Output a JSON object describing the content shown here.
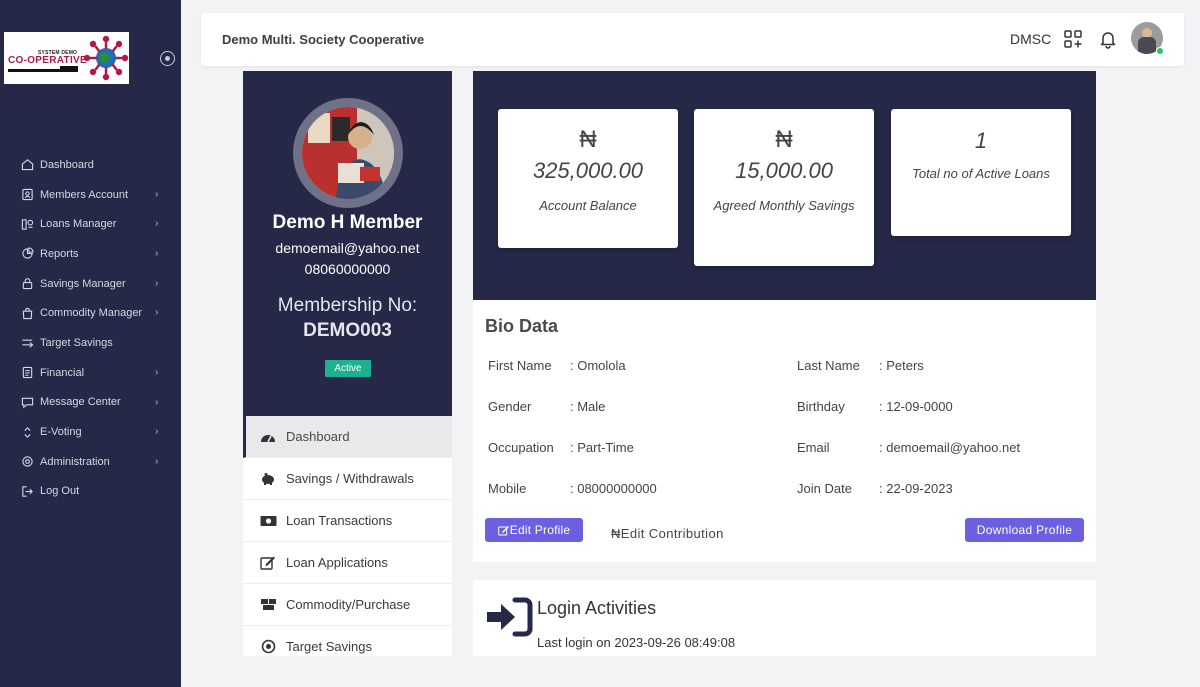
{
  "brand": {
    "logo_small_text": "SYSTEM DEMO",
    "logo_main_text": "CO-OPERATIVE"
  },
  "sidebar": {
    "items": [
      {
        "label": "Dashboard",
        "icon": "home-icon",
        "has_submenu": false
      },
      {
        "label": "Members Account",
        "icon": "user-book-icon",
        "has_submenu": true
      },
      {
        "label": "Loans Manager",
        "icon": "loans-icon",
        "has_submenu": true
      },
      {
        "label": "Reports",
        "icon": "pie-chart-icon",
        "has_submenu": true
      },
      {
        "label": "Savings Manager",
        "icon": "lock-icon",
        "has_submenu": true
      },
      {
        "label": "Commodity Manager",
        "icon": "shopping-bag-icon",
        "has_submenu": true
      },
      {
        "label": "Target Savings",
        "icon": "target-arrow-icon",
        "has_submenu": false
      },
      {
        "label": "Financial",
        "icon": "ledger-icon",
        "has_submenu": true
      },
      {
        "label": "Message Center",
        "icon": "message-icon",
        "has_submenu": true
      },
      {
        "label": "E-Voting",
        "icon": "vote-icon",
        "has_submenu": true
      },
      {
        "label": "Administration",
        "icon": "settings-icon",
        "has_submenu": true
      },
      {
        "label": "Log Out",
        "icon": "logout-icon",
        "has_submenu": false
      }
    ]
  },
  "header": {
    "org_title": "Demo Multi. Society Cooperative",
    "org_code": "DMSC"
  },
  "profile": {
    "name": "Demo H Member",
    "email": "demoemail@yahoo.net",
    "phone": "08060000000",
    "membership_label": "Membership No:",
    "membership_no": "DEMO003",
    "status": "Active"
  },
  "member_menu": {
    "items": [
      {
        "label": "Dashboard",
        "active": true
      },
      {
        "label": "Savings / Withdrawals",
        "active": false
      },
      {
        "label": "Loan Transactions",
        "active": false
      },
      {
        "label": "Loan Applications",
        "active": false
      },
      {
        "label": "Commodity/Purchase",
        "active": false
      },
      {
        "label": "Target Savings",
        "active": false
      }
    ]
  },
  "stats": {
    "account_balance": {
      "currency": "₦",
      "value": "325,000.00",
      "label": "Account Balance"
    },
    "monthly_savings": {
      "currency": "₦",
      "value": "15,000.00",
      "label": "Agreed Monthly Savings"
    },
    "active_loans": {
      "value": "1",
      "label": "Total no of Active Loans"
    }
  },
  "bio": {
    "title": "Bio Data",
    "fields": [
      {
        "label": "First Name",
        "value": ": Omolola"
      },
      {
        "label": "Last Name",
        "value": ": Peters"
      },
      {
        "label": "Gender",
        "value": ": Male"
      },
      {
        "label": "Birthday",
        "value": ": 12-09-0000"
      },
      {
        "label": "Occupation",
        "value": ": Part-Time"
      },
      {
        "label": "Email",
        "value": ": demoemail@yahoo.net"
      },
      {
        "label": "Mobile",
        "value": ": 08000000000"
      },
      {
        "label": "Join Date",
        "value": ": 22-09-2023"
      }
    ],
    "edit_profile_label": "Edit Profile",
    "edit_contribution_label": "₦Edit Contribution",
    "download_profile_label": "Download Profile"
  },
  "login_activities": {
    "title": "Login Activities",
    "last_login": "Last login on 2023-09-26 08:49:08"
  },
  "colors": {
    "sidebar_bg": "#252846",
    "accent_button": "#6c5fe0",
    "status_active": "#1fb18f",
    "online": "#27c46f"
  }
}
